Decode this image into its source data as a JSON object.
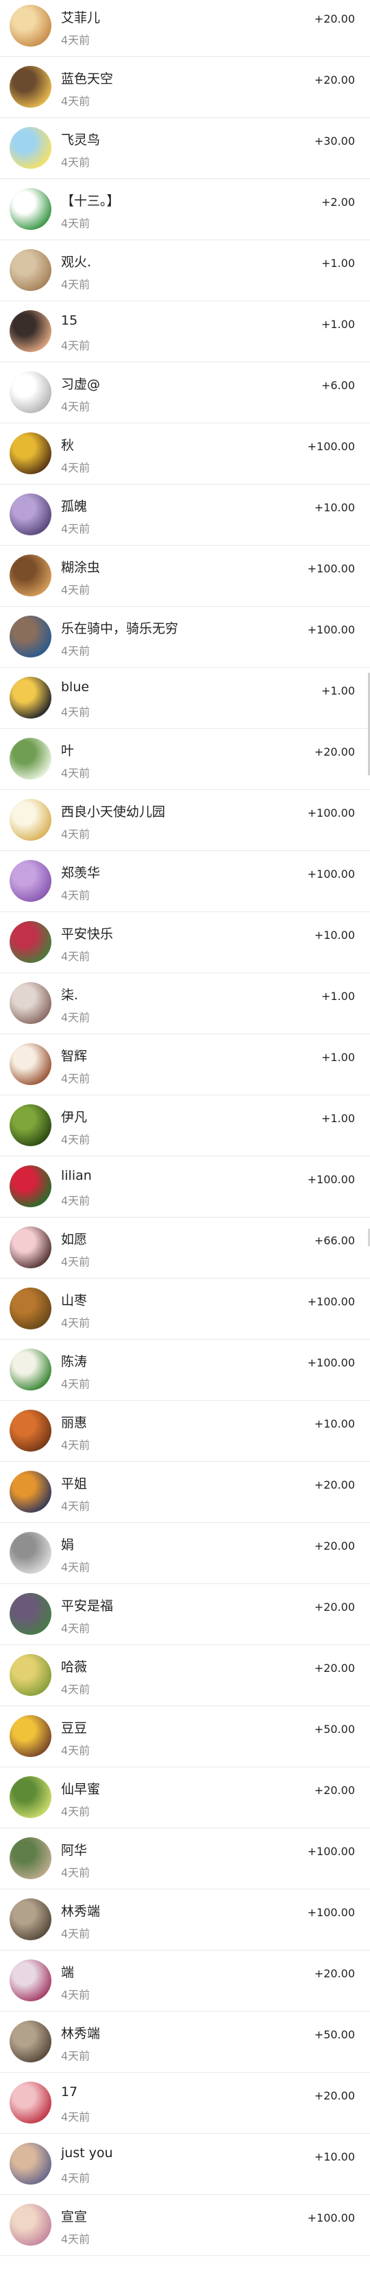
{
  "accent": "#222222",
  "subtle": "#8e8e8e",
  "rows": [
    {
      "name": "艾菲儿",
      "time": "4天前",
      "amount": "+20.00",
      "avatar_icon": "girl-face-avatar",
      "colors": [
        "#f3d9a3",
        "#c98f4e"
      ]
    },
    {
      "name": "蓝色天空",
      "time": "4天前",
      "amount": "+20.00",
      "avatar_icon": "flower-avatar",
      "colors": [
        "#6b4b2e",
        "#e3b54c"
      ]
    },
    {
      "name": "飞灵鸟",
      "time": "4天前",
      "amount": "+30.00",
      "avatar_icon": "cartoon-bird-avatar",
      "colors": [
        "#9fd4f0",
        "#f2e06b"
      ]
    },
    {
      "name": "【十三。】",
      "time": "4天前",
      "amount": "+2.00",
      "avatar_icon": "anime-boy-avatar",
      "colors": [
        "#ffffff",
        "#3e9a4a"
      ]
    },
    {
      "name": "观火.",
      "time": "4天前",
      "amount": "+1.00",
      "avatar_icon": "dog-avatar",
      "colors": [
        "#d8c3a3",
        "#a8845d"
      ]
    },
    {
      "name": "15",
      "time": "4天前",
      "amount": "+1.00",
      "avatar_icon": "child-photo-avatar",
      "colors": [
        "#3a2e2a",
        "#d9a27e"
      ]
    },
    {
      "name": "习虚@",
      "time": "4天前",
      "amount": "+6.00",
      "avatar_icon": "sketch-avatar",
      "colors": [
        "#ffffff",
        "#b8b8b8"
      ]
    },
    {
      "name": "秋",
      "time": "4天前",
      "amount": "+100.00",
      "avatar_icon": "sunflower-avatar",
      "colors": [
        "#e6b832",
        "#5c3a14"
      ]
    },
    {
      "name": "孤魄",
      "time": "4天前",
      "amount": "+10.00",
      "avatar_icon": "purple-sky-avatar",
      "colors": [
        "#b7a1d6",
        "#5b4a7e"
      ]
    },
    {
      "name": "糊涂虫",
      "time": "4天前",
      "amount": "+100.00",
      "avatar_icon": "market-photo-avatar",
      "colors": [
        "#7b4e2a",
        "#d29a58"
      ]
    },
    {
      "name": "乐在骑中，骑乐无穷",
      "time": "4天前",
      "amount": "+100.00",
      "avatar_icon": "cyclists-avatar",
      "colors": [
        "#8a6e5c",
        "#2e5a8c"
      ]
    },
    {
      "name": "blue",
      "time": "4天前",
      "amount": "+1.00",
      "avatar_icon": "emoji-avatar",
      "colors": [
        "#f2c94c",
        "#2b2b2b"
      ]
    },
    {
      "name": "叶",
      "time": "4天前",
      "amount": "+20.00",
      "avatar_icon": "plant-avatar",
      "colors": [
        "#6f9e52",
        "#e4efd8"
      ]
    },
    {
      "name": "西良小天使幼儿园",
      "time": "4天前",
      "amount": "+100.00",
      "avatar_icon": "angel-logo-avatar",
      "colors": [
        "#fbf6e4",
        "#d9b45c"
      ]
    },
    {
      "name": "郑羡华",
      "time": "4天前",
      "amount": "+100.00",
      "avatar_icon": "purple-flower-avatar",
      "colors": [
        "#c7a2e0",
        "#8a5bb3"
      ]
    },
    {
      "name": "平安快乐",
      "time": "4天前",
      "amount": "+10.00",
      "avatar_icon": "red-flower-avatar",
      "colors": [
        "#c2314a",
        "#4d7a3c"
      ]
    },
    {
      "name": "柒.",
      "time": "4天前",
      "amount": "+1.00",
      "avatar_icon": "portrait-avatar",
      "colors": [
        "#e2d6d0",
        "#8c6f66"
      ]
    },
    {
      "name": "智辉",
      "time": "4天前",
      "amount": "+1.00",
      "avatar_icon": "illustrated-girl-avatar",
      "colors": [
        "#f7ede0",
        "#9c5a3c"
      ]
    },
    {
      "name": "伊凡",
      "time": "4天前",
      "amount": "+1.00",
      "avatar_icon": "green-sign-avatar",
      "colors": [
        "#7fa63a",
        "#2f4d14"
      ]
    },
    {
      "name": "lilian",
      "time": "4天前",
      "amount": "+100.00",
      "avatar_icon": "red-rose-avatar",
      "colors": [
        "#d6223b",
        "#2e6b2a"
      ]
    },
    {
      "name": "如愿",
      "time": "4天前",
      "amount": "+66.00",
      "avatar_icon": "smiling-girl-avatar",
      "colors": [
        "#f3cdd0",
        "#5a3a3a"
      ]
    },
    {
      "name": "山枣",
      "time": "4天前",
      "amount": "+100.00",
      "avatar_icon": "fruit-basket-avatar",
      "colors": [
        "#b7772c",
        "#6c4a1a"
      ]
    },
    {
      "name": "陈涛",
      "time": "4天前",
      "amount": "+100.00",
      "avatar_icon": "calligraphy-avatar",
      "colors": [
        "#f2f2e6",
        "#3f8a3a"
      ]
    },
    {
      "name": "丽惠",
      "time": "4天前",
      "amount": "+10.00",
      "avatar_icon": "lantern-avatar",
      "colors": [
        "#d9702e",
        "#7a3a18"
      ]
    },
    {
      "name": "平姐",
      "time": "4天前",
      "amount": "+20.00",
      "avatar_icon": "sunset-people-avatar",
      "colors": [
        "#e5952e",
        "#3c3c58"
      ]
    },
    {
      "name": "娟",
      "time": "4天前",
      "amount": "+20.00",
      "avatar_icon": "cat-avatar",
      "colors": [
        "#8f8f8f",
        "#d8d8d8"
      ]
    },
    {
      "name": "平安是福",
      "time": "4天前",
      "amount": "+20.00",
      "avatar_icon": "lotus-avatar",
      "colors": [
        "#6a5a78",
        "#4a7a4a"
      ]
    },
    {
      "name": "哈薇",
      "time": "4天前",
      "amount": "+20.00",
      "avatar_icon": "citrus-avatar",
      "colors": [
        "#e3d070",
        "#8aa03c"
      ]
    },
    {
      "name": "豆豆",
      "time": "4天前",
      "amount": "+50.00",
      "avatar_icon": "yellow-flower-avatar",
      "colors": [
        "#f0c23a",
        "#7c4a2a"
      ]
    },
    {
      "name": "仙早蜜",
      "time": "4天前",
      "amount": "+20.00",
      "avatar_icon": "green-leaf-avatar",
      "colors": [
        "#5e8c36",
        "#c7d86a"
      ]
    },
    {
      "name": "阿华",
      "time": "4天前",
      "amount": "+100.00",
      "avatar_icon": "garden-avatar",
      "colors": [
        "#5f7e4a",
        "#b8a88a"
      ]
    },
    {
      "name": "林秀端",
      "time": "4天前",
      "amount": "+100.00",
      "avatar_icon": "old-building-avatar",
      "colors": [
        "#b2a28c",
        "#5b4d3e"
      ]
    },
    {
      "name": "端",
      "time": "4天前",
      "amount": "+20.00",
      "avatar_icon": "pagoda-avatar",
      "colors": [
        "#e8d8e4",
        "#a6426a"
      ]
    },
    {
      "name": "林秀端",
      "time": "4天前",
      "amount": "+50.00",
      "avatar_icon": "old-building-avatar",
      "colors": [
        "#b2a28c",
        "#5b4d3e"
      ]
    },
    {
      "name": "17",
      "time": "4天前",
      "amount": "+20.00",
      "avatar_icon": "woman-in-red-avatar",
      "colors": [
        "#f2c1c6",
        "#c23a4a"
      ]
    },
    {
      "name": "just you",
      "time": "4天前",
      "amount": "+10.00",
      "avatar_icon": "sea-sunset-avatar",
      "colors": [
        "#d9b89c",
        "#6c6a8c"
      ]
    },
    {
      "name": "宣宣",
      "time": "4天前",
      "amount": "+100.00",
      "avatar_icon": "child-with-flowers-avatar",
      "colors": [
        "#f0d6c4",
        "#c68aa0"
      ]
    }
  ]
}
